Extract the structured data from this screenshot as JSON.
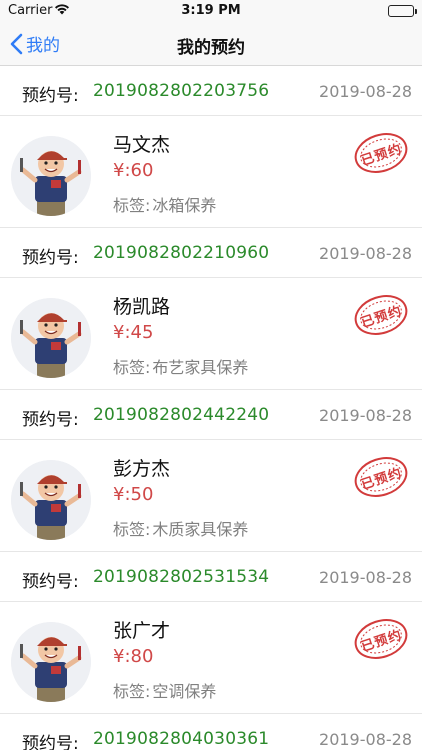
{
  "status_bar": {
    "carrier": "Carrier",
    "time": "3:19 PM"
  },
  "nav": {
    "back_label": "我的",
    "title": "我的预约"
  },
  "labels": {
    "order_no": "预约号:",
    "tag_prefix": "标签:",
    "stamp": "已预约"
  },
  "colors": {
    "accent_blue": "#2f7cf6",
    "order_green": "#2b8a2b",
    "price_red": "#d04848",
    "stamp_red": "#d23b3b"
  },
  "bookings": [
    {
      "order_no": "2019082802203756",
      "date": "2019-08-28",
      "name": "马文杰",
      "price": "¥:60",
      "tag": "冰箱保养"
    },
    {
      "order_no": "2019082802210960",
      "date": "2019-08-28",
      "name": "杨凯路",
      "price": "¥:45",
      "tag": "布艺家具保养"
    },
    {
      "order_no": "2019082802442240",
      "date": "2019-08-28",
      "name": "彭方杰",
      "price": "¥:50",
      "tag": "木质家具保养"
    },
    {
      "order_no": "2019082802531534",
      "date": "2019-08-28",
      "name": "张广才",
      "price": "¥:80",
      "tag": "空调保养"
    },
    {
      "order_no": "2019082804030361",
      "date": "2019-08-28"
    }
  ]
}
